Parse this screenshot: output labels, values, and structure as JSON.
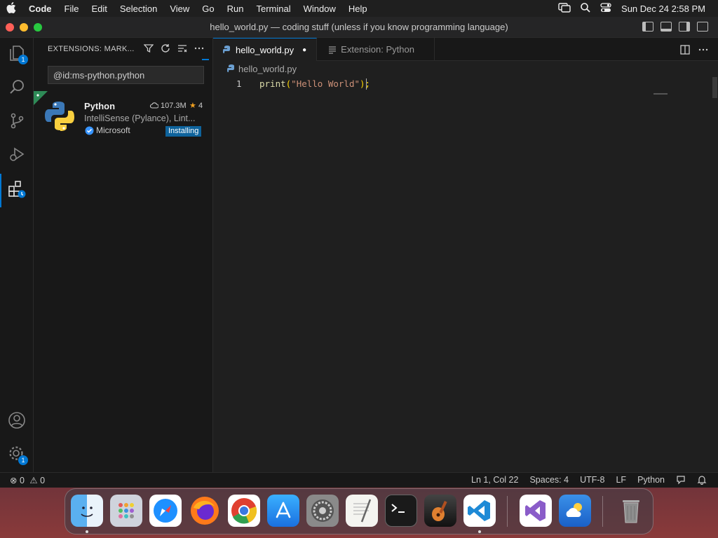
{
  "menubar": {
    "apple": "",
    "app": "Code",
    "items": [
      "File",
      "Edit",
      "Selection",
      "View",
      "Go",
      "Run",
      "Terminal",
      "Window",
      "Help"
    ],
    "datetime": "Sun Dec 24  2:58 PM"
  },
  "window": {
    "title": "hello_world.py — coding stuff (unless if you know programming language)"
  },
  "activity": {
    "explorer_badge": "1",
    "settings_badge": "1"
  },
  "sidebar": {
    "header": "EXTENSIONS: MARK...",
    "search_value": "@id:ms-python.python",
    "extension": {
      "name": "Python",
      "downloads": "107.3M",
      "rating": "4",
      "description": "IntelliSense (Pylance), Lint...",
      "publisher": "Microsoft",
      "status": "Installing"
    }
  },
  "editor": {
    "tabs": [
      {
        "label": "hello_world.py",
        "modified": "●"
      },
      {
        "label": "Extension: Python"
      }
    ],
    "breadcrumb": "hello_world.py",
    "line_number": "1",
    "code": {
      "fn": "print",
      "open": "(",
      "string": "\"Hello World\"",
      "close": ");"
    }
  },
  "status": {
    "errors": "0",
    "warnings": "0",
    "position": "Ln 1, Col 22",
    "spaces": "Spaces: 4",
    "encoding": "UTF-8",
    "eol": "LF",
    "language": "Python"
  },
  "colors": {
    "accent": "#0078d4",
    "string": "#ce9178",
    "function": "#dcdcaa"
  }
}
